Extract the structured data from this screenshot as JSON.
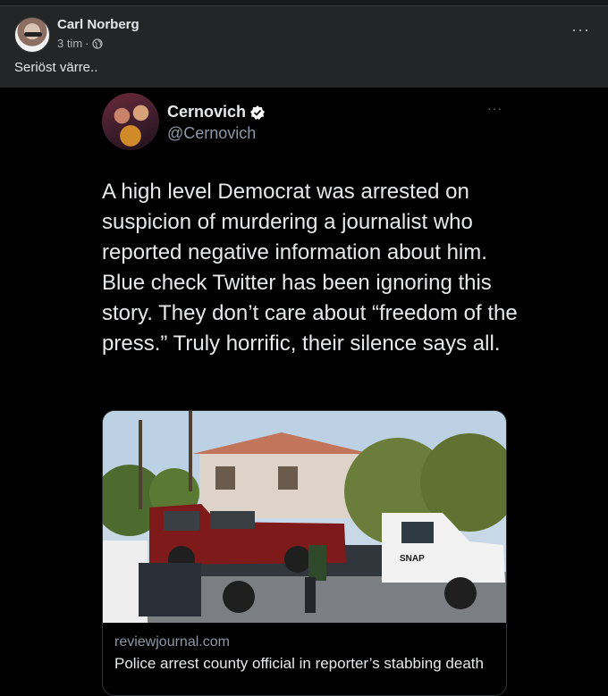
{
  "post": {
    "author": "Carl Norberg",
    "time": "3 tim",
    "separator": "·",
    "text": "Seriöst värre..",
    "more_label": "···",
    "audience_icon": "globe-icon"
  },
  "tweet": {
    "name": "Cernovich",
    "handle": "@Cernovich",
    "verified_icon": "verified-badge-icon",
    "more_label": "···",
    "text": "A high level Democrat was arrested on suspicion of murdering a journalist who reported negative information about him. Blue check Twitter has been ignoring this story. They don’t care about “freedom of the press.” Truly horrific, their silence says all.",
    "card": {
      "domain": "reviewjournal.com",
      "title": "Police arrest county official in reporter’s stabbing death",
      "photo_text": "SNAP"
    }
  },
  "colors": {
    "background": "#18191a",
    "post_bg": "#242526",
    "tweet_bg": "#000000",
    "verified": "#ffffff"
  }
}
